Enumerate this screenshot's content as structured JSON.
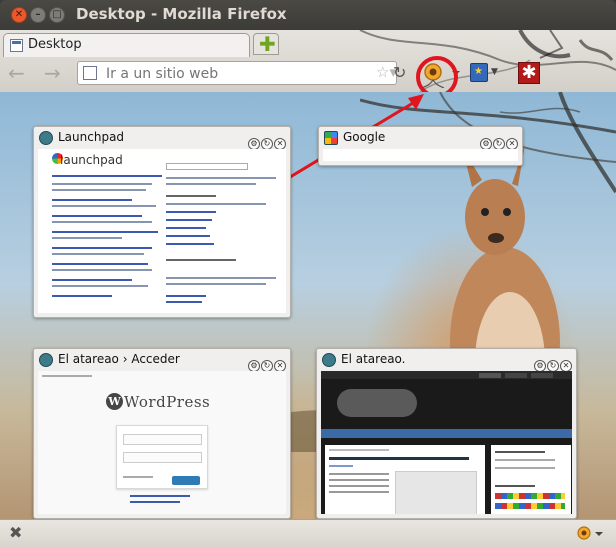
{
  "window": {
    "title": "Desktop - Mozilla Firefox"
  },
  "tabs": [
    {
      "label": "Desktop"
    }
  ],
  "toolbar": {
    "back": "←",
    "forward": "→",
    "url_placeholder": "Ir a un sitio web",
    "reload": "↻",
    "new_tab": "✚"
  },
  "groups": [
    {
      "title": "Launchpad",
      "logo": "launchpad"
    },
    {
      "title": "Google"
    },
    {
      "title": "El atareao › Acceder",
      "logo": "WordPress"
    },
    {
      "title": "El atareao."
    }
  ],
  "statusbar": {
    "close": "✖"
  },
  "icons": [
    "back-arrow-icon",
    "forward-arrow-icon",
    "bookmark-star-icon",
    "reload-icon",
    "tab-groups-icon",
    "bookmarks-icon",
    "addon-icon",
    "close-icon",
    "panorama-icon"
  ],
  "colors": {
    "annotation": "#e0151d",
    "titlebar": "#3c3b37",
    "chrome": "#dcd8d2"
  }
}
